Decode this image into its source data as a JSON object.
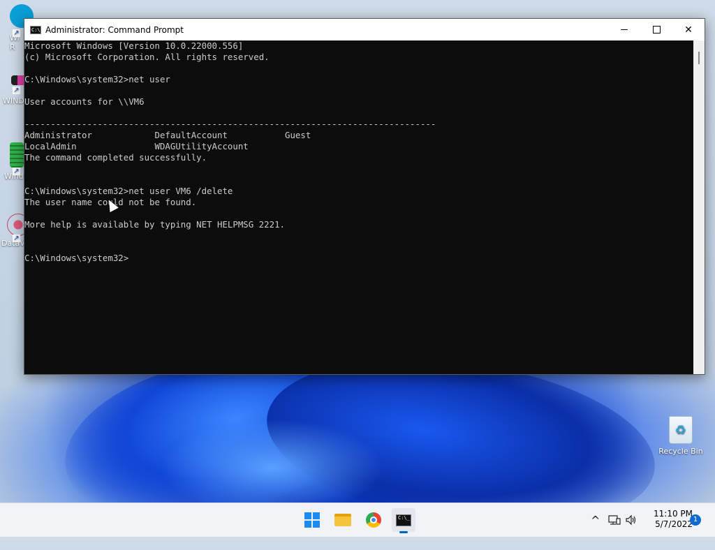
{
  "desktop": {
    "icons": [
      {
        "label": "Wi\nR",
        "icon": "app-shortcut-icon"
      },
      {
        "label": "WIND",
        "icon": "app-shortcut-icon"
      },
      {
        "label": "Wind",
        "icon": "app-shortcut-icon"
      },
      {
        "label": "DataV",
        "icon": "app-shortcut-icon"
      }
    ],
    "recycle_bin": {
      "label": "Recycle Bin",
      "icon": "recycle-bin-icon"
    }
  },
  "window": {
    "title": "Administrator: Command Prompt",
    "icon": "cmd-icon",
    "controls": {
      "minimize": "minimize-icon",
      "maximize": "maximize-icon",
      "close": "close-icon",
      "close_label": "✕"
    },
    "console_lines": [
      "Microsoft Windows [Version 10.0.22000.556]",
      "(c) Microsoft Corporation. All rights reserved.",
      "",
      "C:\\Windows\\system32>net user",
      "",
      "User accounts for \\\\VM6",
      "",
      "-------------------------------------------------------------------------------",
      "Administrator            DefaultAccount           Guest",
      "LocalAdmin               WDAGUtilityAccount",
      "The command completed successfully.",
      "",
      "",
      "C:\\Windows\\system32>net user VM6 /delete",
      "The user name could not be found.",
      "",
      "More help is available by typing NET HELPMSG 2221.",
      "",
      "",
      "C:\\Windows\\system32>"
    ]
  },
  "taskbar": {
    "apps": [
      {
        "name": "start",
        "icon": "windows-start-icon"
      },
      {
        "name": "file-explorer",
        "icon": "folder-icon"
      },
      {
        "name": "chrome",
        "icon": "chrome-icon"
      },
      {
        "name": "command-prompt",
        "icon": "terminal-icon",
        "active": true
      }
    ],
    "tray": {
      "chevron": "^",
      "network_icon": "network-icon",
      "volume_icon": "volume-icon"
    },
    "clock": {
      "time": "11:10 PM",
      "date": "5/7/2022"
    },
    "notification_count": "1"
  },
  "colors": {
    "console_bg": "#0c0c0c",
    "console_fg": "#cccccc",
    "accent": "#0067c0"
  }
}
